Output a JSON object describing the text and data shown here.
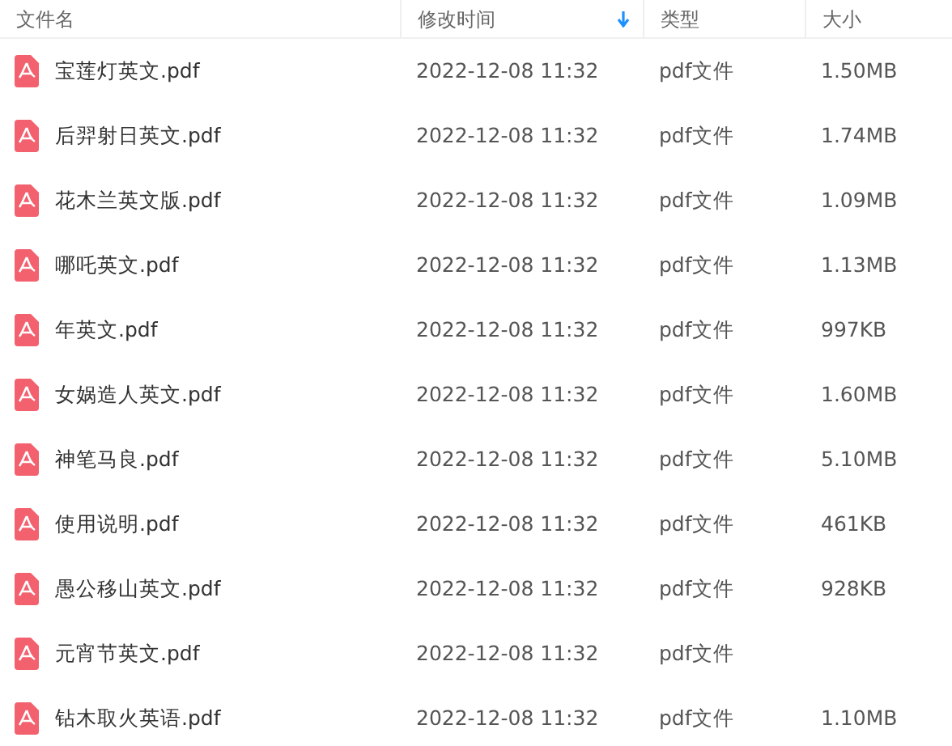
{
  "table": {
    "columns": [
      {
        "label": "文件名",
        "sorted": false
      },
      {
        "label": "修改时间",
        "sorted": true
      },
      {
        "label": "类型",
        "sorted": false
      },
      {
        "label": "大小",
        "sorted": false
      }
    ],
    "rows": [
      {
        "name": "宝莲灯英文.pdf",
        "modified": "2022-12-08 11:32",
        "type": "pdf文件",
        "size": "1.50MB"
      },
      {
        "name": "后羿射日英文.pdf",
        "modified": "2022-12-08 11:32",
        "type": "pdf文件",
        "size": "1.74MB"
      },
      {
        "name": "花木兰英文版.pdf",
        "modified": "2022-12-08 11:32",
        "type": "pdf文件",
        "size": "1.09MB"
      },
      {
        "name": "哪吒英文.pdf",
        "modified": "2022-12-08 11:32",
        "type": "pdf文件",
        "size": "1.13MB"
      },
      {
        "name": "年英文.pdf",
        "modified": "2022-12-08 11:32",
        "type": "pdf文件",
        "size": "997KB"
      },
      {
        "name": "女娲造人英文.pdf",
        "modified": "2022-12-08 11:32",
        "type": "pdf文件",
        "size": "1.60MB"
      },
      {
        "name": "神笔马良.pdf",
        "modified": "2022-12-08 11:32",
        "type": "pdf文件",
        "size": "5.10MB"
      },
      {
        "name": "使用说明.pdf",
        "modified": "2022-12-08 11:32",
        "type": "pdf文件",
        "size": "461KB"
      },
      {
        "name": "愚公移山英文.pdf",
        "modified": "2022-12-08 11:32",
        "type": "pdf文件",
        "size": "928KB"
      },
      {
        "name": "元宵节英文.pdf",
        "modified": "2022-12-08 11:32",
        "type": "pdf文件"
      },
      {
        "name": "钻木取火英语.pdf",
        "modified": "2022-12-08 11:32",
        "type": "pdf文件",
        "size": "1.10MB"
      }
    ]
  }
}
